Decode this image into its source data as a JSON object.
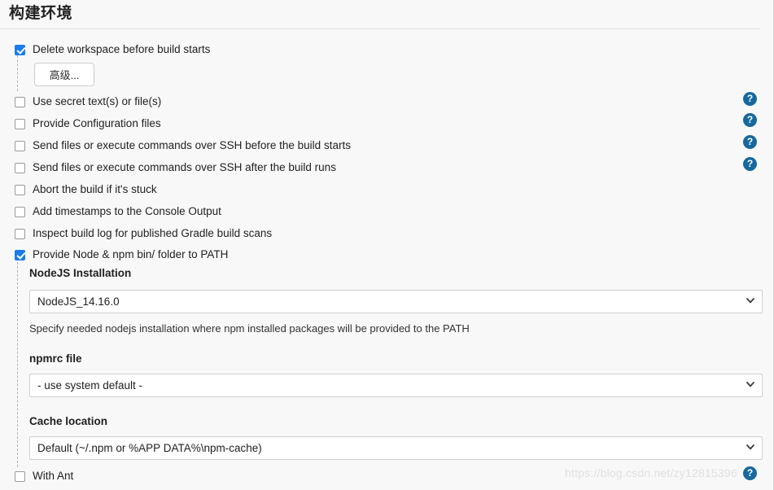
{
  "section": {
    "title": "构建环境"
  },
  "checkboxes": [
    {
      "label": "Delete workspace before build starts",
      "checked": true,
      "help": false
    },
    {
      "label": "Use secret text(s) or file(s)",
      "checked": false,
      "help": true
    },
    {
      "label": "Provide Configuration files",
      "checked": false,
      "help": true
    },
    {
      "label": "Send files or execute commands over SSH before the build starts",
      "checked": false,
      "help": true
    },
    {
      "label": "Send files or execute commands over SSH after the build runs",
      "checked": false,
      "help": true
    },
    {
      "label": "Abort the build if it's stuck",
      "checked": false,
      "help": false
    },
    {
      "label": "Add timestamps to the Console Output",
      "checked": false,
      "help": false
    },
    {
      "label": "Inspect build log for published Gradle build scans",
      "checked": false,
      "help": false
    },
    {
      "label": "Provide Node & npm bin/ folder to PATH",
      "checked": true,
      "help": false
    },
    {
      "label": "With Ant",
      "checked": false,
      "help": true
    }
  ],
  "advanced_button": {
    "label": "高级..."
  },
  "fields": {
    "nodejs_installation": {
      "label": "NodeJS Installation",
      "value": "NodeJS_14.16.0",
      "description": "Specify needed nodejs installation where npm installed packages will be provided to the PATH"
    },
    "npmrc_file": {
      "label": "npmrc file",
      "value": "- use system default -"
    },
    "cache_location": {
      "label": "Cache location",
      "value": "Default (~/.npm or %APP DATA%\\npm-cache)"
    }
  },
  "icons": {
    "help": "?",
    "chevron_down": "chevron-down-icon"
  },
  "watermark": {
    "text": "https://blog.csdn.net/zy12815396"
  },
  "colors": {
    "accent_checkbox": "#1b7ced",
    "help_icon": "#16699e",
    "background": "#f8f8f8"
  }
}
